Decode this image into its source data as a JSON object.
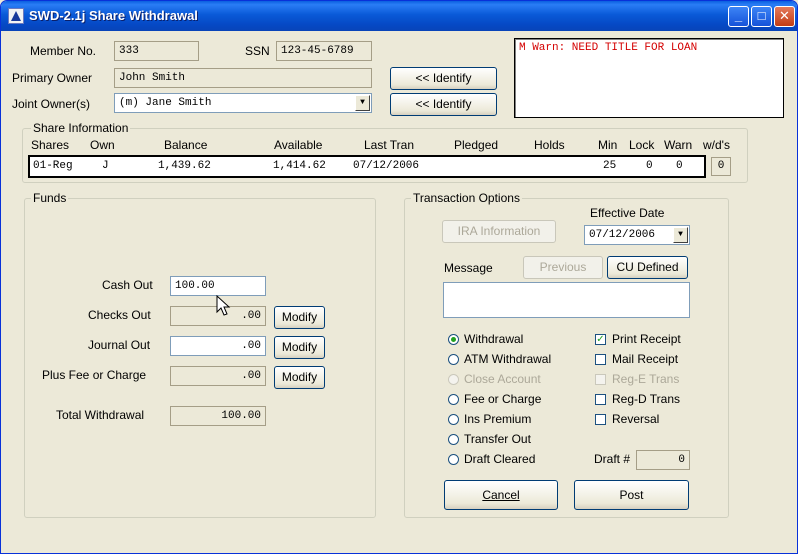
{
  "window": {
    "title": "SWD-2.1j Share Withdrawal",
    "controls": {
      "minimize": "_",
      "maximize": "□",
      "close": "✕"
    }
  },
  "member": {
    "member_no_label": "Member No.",
    "member_no": "333",
    "ssn_label": "SSN",
    "ssn": "123-45-6789",
    "primary_owner_label": "Primary Owner",
    "primary_owner": "John Smith",
    "joint_owner_label": "Joint Owner(s)",
    "joint_owner": "(m) Jane Smith",
    "identify_label": "<< Identify",
    "identify2_label": "<< Identify"
  },
  "warning": {
    "text": "M Warn: NEED TITLE FOR LOAN",
    "color": "#d40000"
  },
  "share_info": {
    "title": "Share Information",
    "headers": [
      "Shares",
      "Own",
      "Balance",
      "Available",
      "Last Tran",
      "Pledged",
      "Holds",
      "Min",
      "Lock",
      "Warn",
      "w/d's"
    ],
    "row": {
      "shares": "01-Reg",
      "own": "J",
      "balance": "1,439.62",
      "available": "1,414.62",
      "last_tran": "07/12/2006",
      "pledged": "",
      "holds": "",
      "min": "25",
      "lock": "0",
      "warn": "0",
      "wds": "0"
    }
  },
  "funds": {
    "title": "Funds",
    "cash_out_label": "Cash Out",
    "cash_out": "100.00",
    "checks_out_label": "Checks Out",
    "checks_out": ".00",
    "journal_out_label": "Journal Out",
    "journal_out": ".00",
    "fee_label": "Plus Fee or Charge",
    "fee": ".00",
    "total_label": "Total Withdrawal",
    "total": "100.00",
    "modify_label": "Modify"
  },
  "transaction": {
    "title": "Transaction Options",
    "ira_label": "IRA Information",
    "effective_date_label": "Effective Date",
    "effective_date": "07/12/2006",
    "message_label": "Message",
    "previous_label": "Previous",
    "cu_defined_label": "CU Defined",
    "message": "",
    "options": [
      {
        "label": "Withdrawal",
        "checked": true,
        "disabled": false
      },
      {
        "label": "ATM Withdrawal",
        "checked": false,
        "disabled": false
      },
      {
        "label": "Close Account",
        "checked": false,
        "disabled": true
      },
      {
        "label": "Fee or Charge",
        "checked": false,
        "disabled": false
      },
      {
        "label": "Ins Premium",
        "checked": false,
        "disabled": false
      },
      {
        "label": "Transfer Out",
        "checked": false,
        "disabled": false
      },
      {
        "label": "Draft Cleared",
        "checked": false,
        "disabled": false
      }
    ],
    "checks": [
      {
        "label": "Print Receipt",
        "checked": true,
        "disabled": false
      },
      {
        "label": "Mail Receipt",
        "checked": false,
        "disabled": false
      },
      {
        "label": "Reg-E Trans",
        "checked": false,
        "disabled": true
      },
      {
        "label": "Reg-D Trans",
        "checked": false,
        "disabled": false
      },
      {
        "label": "Reversal",
        "checked": false,
        "disabled": false
      }
    ],
    "draft_label": "Draft #",
    "draft": "0",
    "cancel_label": "Cancel",
    "post_label": "Post"
  }
}
